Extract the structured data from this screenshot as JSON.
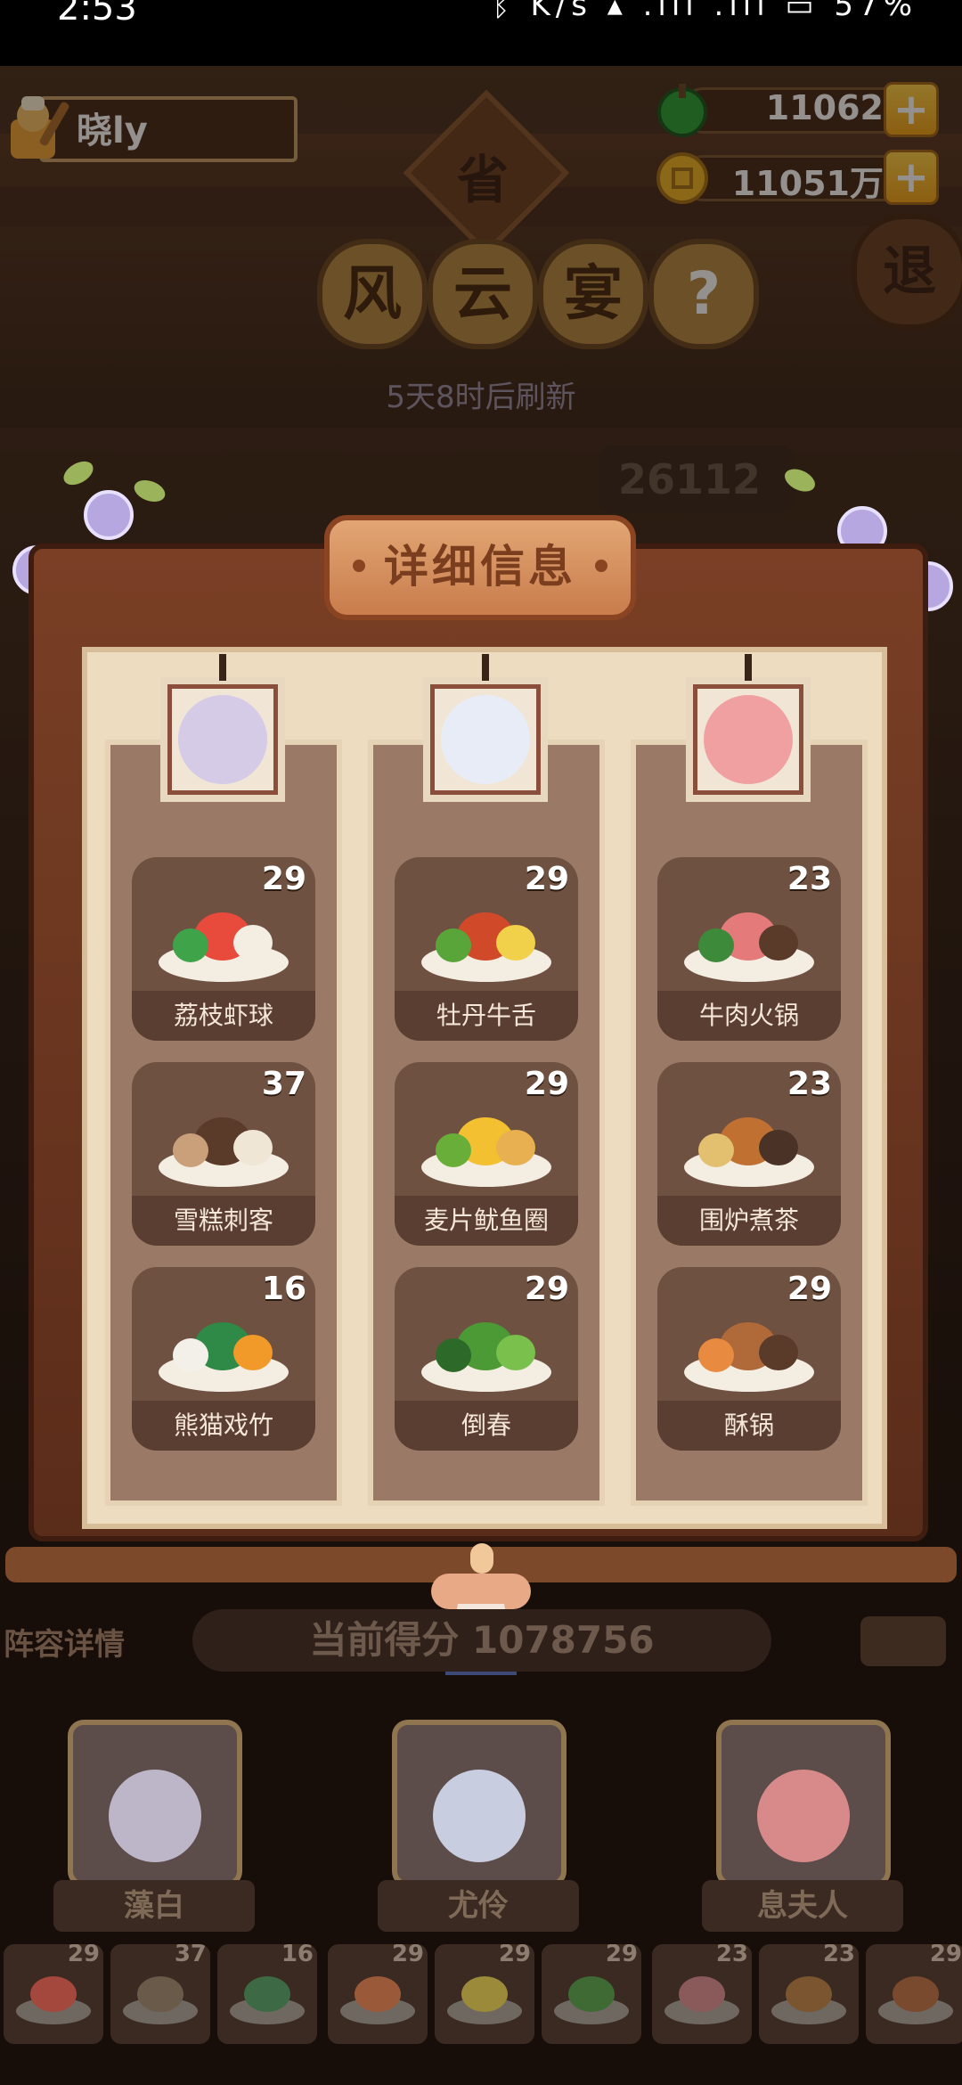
{
  "status_bar": {
    "time": "2:53",
    "icons": "ᛒ K/s ▴ .ıll .ıll ▭ 57%"
  },
  "player": {
    "name": "晓ly"
  },
  "currencies": [
    {
      "name": "jade",
      "value": "11062",
      "icon": "green-gem-icon",
      "color": "#2fa33a"
    },
    {
      "name": "coins",
      "value": "11051万",
      "icon": "gold-coin-icon",
      "color": "#f0b728"
    }
  ],
  "background": {
    "plaque": "省",
    "title_chars": [
      "风",
      "云",
      "宴"
    ],
    "help_char": "?",
    "exit_label": "退",
    "refresh_text": "5天8时后刷新",
    "score_partial": "26112"
  },
  "panel": {
    "title": "详细信息",
    "columns": [
      {
        "portrait": "purple-haired-girl-portrait",
        "dishes": [
          {
            "name": "荔枝虾球",
            "level": "29",
            "colors": [
              "#e84a3c",
              "#f3ede2",
              "#3fa34a"
            ]
          },
          {
            "name": "雪糕刺客",
            "level": "37",
            "colors": [
              "#5a3a28",
              "#efe6d6",
              "#caa07a"
            ]
          },
          {
            "name": "熊猫戏竹",
            "level": "16",
            "colors": [
              "#2e8a46",
              "#f19a2a",
              "#f3f0ea"
            ]
          }
        ]
      },
      {
        "portrait": "white-haired-girl-portrait",
        "dishes": [
          {
            "name": "牡丹牛舌",
            "level": "29",
            "colors": [
              "#d04a2a",
              "#f2d14a",
              "#5aa53a"
            ]
          },
          {
            "name": "麦片鱿鱼圈",
            "level": "29",
            "colors": [
              "#f2c030",
              "#e8b050",
              "#6aae3a"
            ]
          },
          {
            "name": "倒春",
            "level": "29",
            "colors": [
              "#4c9a35",
              "#7ac04c",
              "#2d6a2a"
            ]
          }
        ]
      },
      {
        "portrait": "red-haired-girl-portrait",
        "dishes": [
          {
            "name": "牛肉火锅",
            "level": "23",
            "colors": [
              "#e47a7a",
              "#5a3a28",
              "#3d8a3a"
            ]
          },
          {
            "name": "围炉煮茶",
            "level": "23",
            "colors": [
              "#c07030",
              "#4a3326",
              "#e2c070"
            ]
          },
          {
            "name": "酥锅",
            "level": "29",
            "colors": [
              "#b06a3a",
              "#5a3a28",
              "#e88a40"
            ]
          }
        ]
      }
    ]
  },
  "lower": {
    "lineup_label": "阵容详情",
    "current_score_text": "当前得分 1078756",
    "characters": [
      {
        "name": "藻白",
        "color": "#bdb6c8"
      },
      {
        "name": "尤伶",
        "color": "#c9cde0"
      },
      {
        "name": "息夫人",
        "color": "#d88a8a"
      }
    ],
    "mini_dishes": [
      {
        "level": "29",
        "color": "#a4473c"
      },
      {
        "level": "37",
        "color": "#6a5a4a"
      },
      {
        "level": "16",
        "color": "#3d6a44"
      },
      {
        "level": "29",
        "color": "#9a5a3a"
      },
      {
        "level": "29",
        "color": "#9a8a3a"
      },
      {
        "level": "29",
        "color": "#3f6a34"
      },
      {
        "level": "23",
        "color": "#8a5a5a"
      },
      {
        "level": "23",
        "color": "#7a5530"
      },
      {
        "level": "29",
        "color": "#7a4a2e"
      }
    ]
  }
}
